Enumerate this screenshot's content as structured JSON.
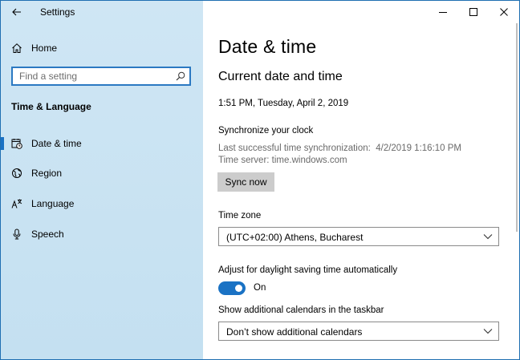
{
  "window": {
    "title": "Settings"
  },
  "sidebar": {
    "home_label": "Home",
    "search_placeholder": "Find a setting",
    "section_title": "Time & Language",
    "items": [
      {
        "label": "Date & time",
        "icon": "calendar-clock-icon",
        "selected": true
      },
      {
        "label": "Region",
        "icon": "globe-icon",
        "selected": false
      },
      {
        "label": "Language",
        "icon": "language-icon",
        "selected": false
      },
      {
        "label": "Speech",
        "icon": "microphone-icon",
        "selected": false
      }
    ]
  },
  "main": {
    "page_title": "Date & time",
    "section_title": "Current date and time",
    "current_datetime": "1:51 PM, Tuesday, April 2, 2019",
    "sync": {
      "heading": "Synchronize your clock",
      "last_sync": "Last successful time synchronization:  4/2/2019 1:16:10 PM",
      "time_server": "Time server: time.windows.com",
      "button_label": "Sync now"
    },
    "time_zone": {
      "label": "Time zone",
      "value": "(UTC+02:00) Athens, Bucharest"
    },
    "daylight": {
      "label": "Adjust for daylight saving time automatically",
      "state": "On"
    },
    "calendars": {
      "label": "Show additional calendars in the taskbar",
      "value": "Don’t show additional calendars"
    }
  },
  "colors": {
    "accent": "#1a72c4",
    "sidebar_bg": "#cfe6f4",
    "button_bg": "#cccccc"
  }
}
